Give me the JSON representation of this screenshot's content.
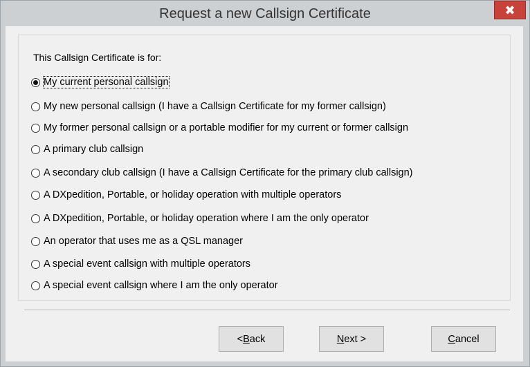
{
  "window": {
    "title": "Request a new Callsign Certificate",
    "close_glyph": "✖"
  },
  "group": {
    "legend": "This Callsign Certificate is for:"
  },
  "options": [
    {
      "label": "My current personal callsign",
      "selected": true
    },
    {
      "label": "My new personal callsign (I have a Callsign Certificate for my former callsign)",
      "selected": false
    },
    {
      "label": "My former personal callsign or a portable modifier for my current or former callsign",
      "selected": false
    },
    {
      "label": "A primary club callsign",
      "selected": false
    },
    {
      "label": "A secondary club callsign (I have a Callsign Certificate for the primary club callsign)",
      "selected": false
    },
    {
      "label": "A DXpedition, Portable, or holiday operation with multiple operators",
      "selected": false
    },
    {
      "label": "A DXpedition, Portable, or holiday operation where I am the only operator",
      "selected": false
    },
    {
      "label": "An operator that uses me as a QSL manager",
      "selected": false
    },
    {
      "label": "A special event callsign with multiple operators",
      "selected": false
    },
    {
      "label": "A special event callsign where I am the only operator",
      "selected": false
    }
  ],
  "buttons": {
    "back": {
      "prefix": "< ",
      "mnemonic": "B",
      "rest": "ack"
    },
    "next": {
      "prefix": "",
      "mnemonic": "N",
      "rest": "ext >"
    },
    "cancel": {
      "prefix": "",
      "mnemonic": "C",
      "rest": "ancel"
    }
  },
  "colors": {
    "close_button": "#c7423a",
    "frame": "#ccd0d3",
    "client": "#f0f0f0"
  }
}
